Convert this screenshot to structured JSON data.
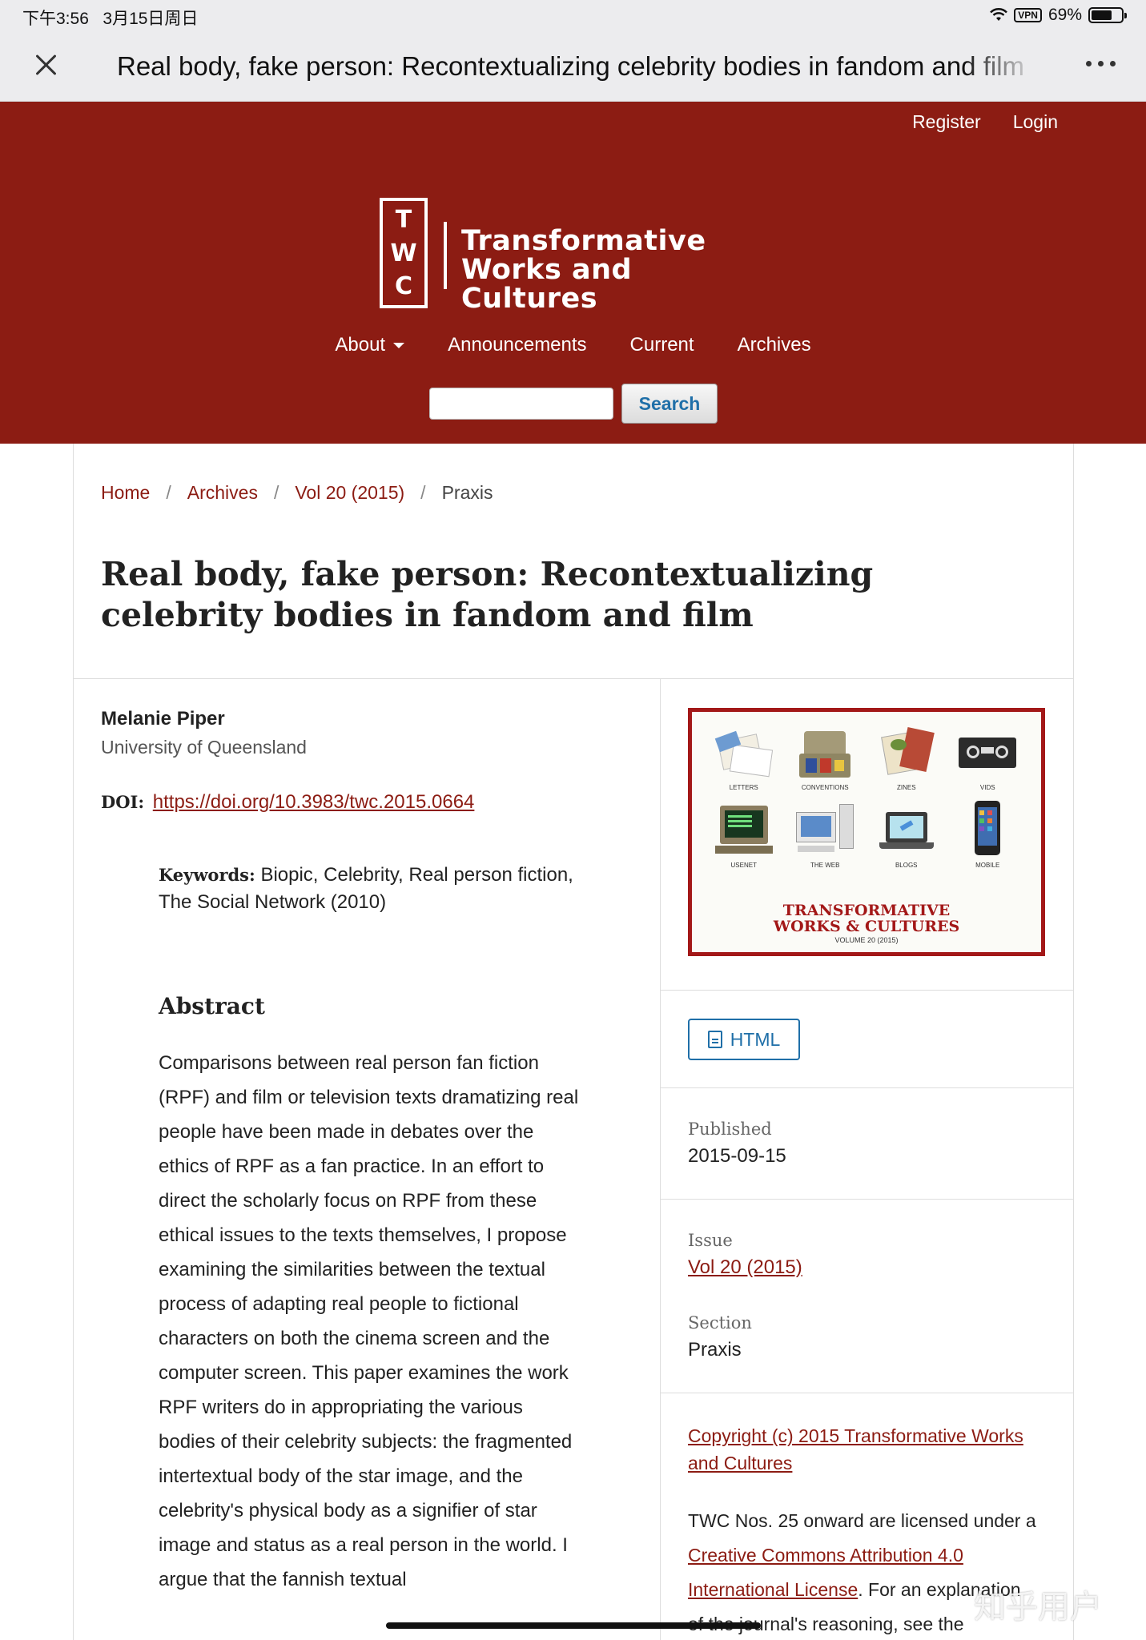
{
  "status_bar": {
    "time": "下午3:56",
    "date": "3月15日周日",
    "vpn": "VPN",
    "battery": "69%",
    "battery_level": 0.69
  },
  "browser": {
    "title": "Real body, fake person: Recontextualizing celebrity bodies in fandom and film"
  },
  "header": {
    "user_links": [
      "Register",
      "Login"
    ],
    "logo_letters": [
      "T",
      "W",
      "C"
    ],
    "logo_name_line1": "Transformative",
    "logo_name_line2": "Works and Cultures",
    "nav": [
      "About",
      "Announcements",
      "Current",
      "Archives"
    ],
    "search_value": "",
    "search_button": "Search"
  },
  "breadcrumb": [
    "Home",
    "Archives",
    "Vol 20 (2015)",
    "Praxis"
  ],
  "article": {
    "title": "Real body, fake person: Recontextualizing celebrity bodies in fandom and film",
    "author": "Melanie Piper",
    "affiliation": "University of Queensland",
    "doi_label": "DOI:",
    "doi_url": "https://doi.org/10.3983/twc.2015.0664",
    "keywords_label": "Keywords:",
    "keywords": "Biopic, Celebrity, Real person fiction, The Social Network (2010)",
    "abstract_heading": "Abstract",
    "abstract": "Comparisons between real person fan fiction (RPF) and film or television texts dramatizing real people have been made in debates over the ethics of RPF as a fan practice. In an effort to direct the scholarly focus on RPF from these ethical issues to the texts themselves, I propose examining the similarities between the textual process of adapting real people to fictional characters on both the cinema screen and the computer screen. This paper examines the work RPF writers do in appropriating the various bodies of their celebrity subjects: the fragmented intertextual body of the star image, and the celebrity's physical body as a signifier of star image and status as a real person in the world. I argue that the fannish textual"
  },
  "cover": {
    "captions": [
      "LETTERS",
      "CONVENTIONS",
      "ZINES",
      "VIDS",
      "USENET",
      "THE WEB",
      "BLOGS",
      "MOBILE"
    ],
    "title_line1": "TRANSFORMATIVE",
    "title_line2": "WORKS & CULTURES",
    "volume": "VOLUME 20 (2015)"
  },
  "sidebar": {
    "galley": "HTML",
    "published_label": "Published",
    "published": "2015-09-15",
    "issue_label": "Issue",
    "issue": "Vol 20 (2015)",
    "section_label": "Section",
    "section": "Praxis",
    "copyright": "Copyright (c) 2015 Transformative Works and Cultures",
    "license_text_1": "TWC Nos. 25 onward are licensed under a",
    "license_link": "Creative Commons Attribution 4.0 International License",
    "license_text_2": ". For an explanation of the journal's reasoning, see  the"
  },
  "watermark": "知乎用户",
  "colors": {
    "brand": "#8c1c13",
    "link_blue": "#1f6fa8"
  }
}
